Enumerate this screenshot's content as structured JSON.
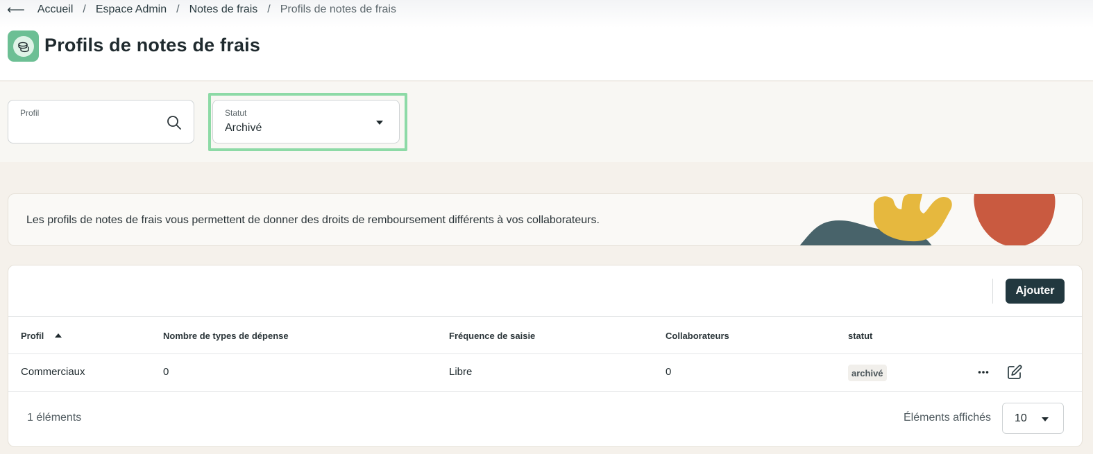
{
  "breadcrumb": {
    "back_icon": "arrow-left-icon",
    "items": [
      "Accueil",
      "Espace Admin",
      "Notes de frais"
    ],
    "separator": "/",
    "current": "Profils de notes de frais"
  },
  "header": {
    "app_icon": "expense-coins-icon",
    "title": "Profils de notes de frais"
  },
  "filters": {
    "profil": {
      "label": "Profil",
      "value": "",
      "icon": "search-icon"
    },
    "statut": {
      "label": "Statut",
      "value": "Archivé",
      "icon": "caret-down-icon",
      "focused": true
    }
  },
  "banner": {
    "text": "Les profils de notes de frais vous permettent de donner des droits de remboursement différents à vos collaborateurs."
  },
  "table": {
    "add_label": "Ajouter",
    "columns": [
      "Profil",
      "Nombre de types de dépense",
      "Fréquence de saisie",
      "Collaborateurs",
      "statut"
    ],
    "sort": {
      "column": "Profil",
      "direction": "ascending"
    },
    "rows": [
      {
        "profil": "Commerciaux",
        "types": "0",
        "frequence": "Libre",
        "collaborateurs": "0",
        "statut": "archivé"
      }
    ],
    "row_actions": [
      "more-icon",
      "edit-icon"
    ],
    "count_text": "1 éléments",
    "page_size_label": "Éléments affichés",
    "page_size_value": "10"
  },
  "colors": {
    "primary_dark": "#22383f",
    "focus_outline": "#8ddaa6",
    "app_icon_bg": "#6cbf94",
    "page_bg": "#f5f1eb",
    "art_yellow": "#e6b83e",
    "art_red": "#c95a40",
    "art_slate": "#48636a"
  }
}
